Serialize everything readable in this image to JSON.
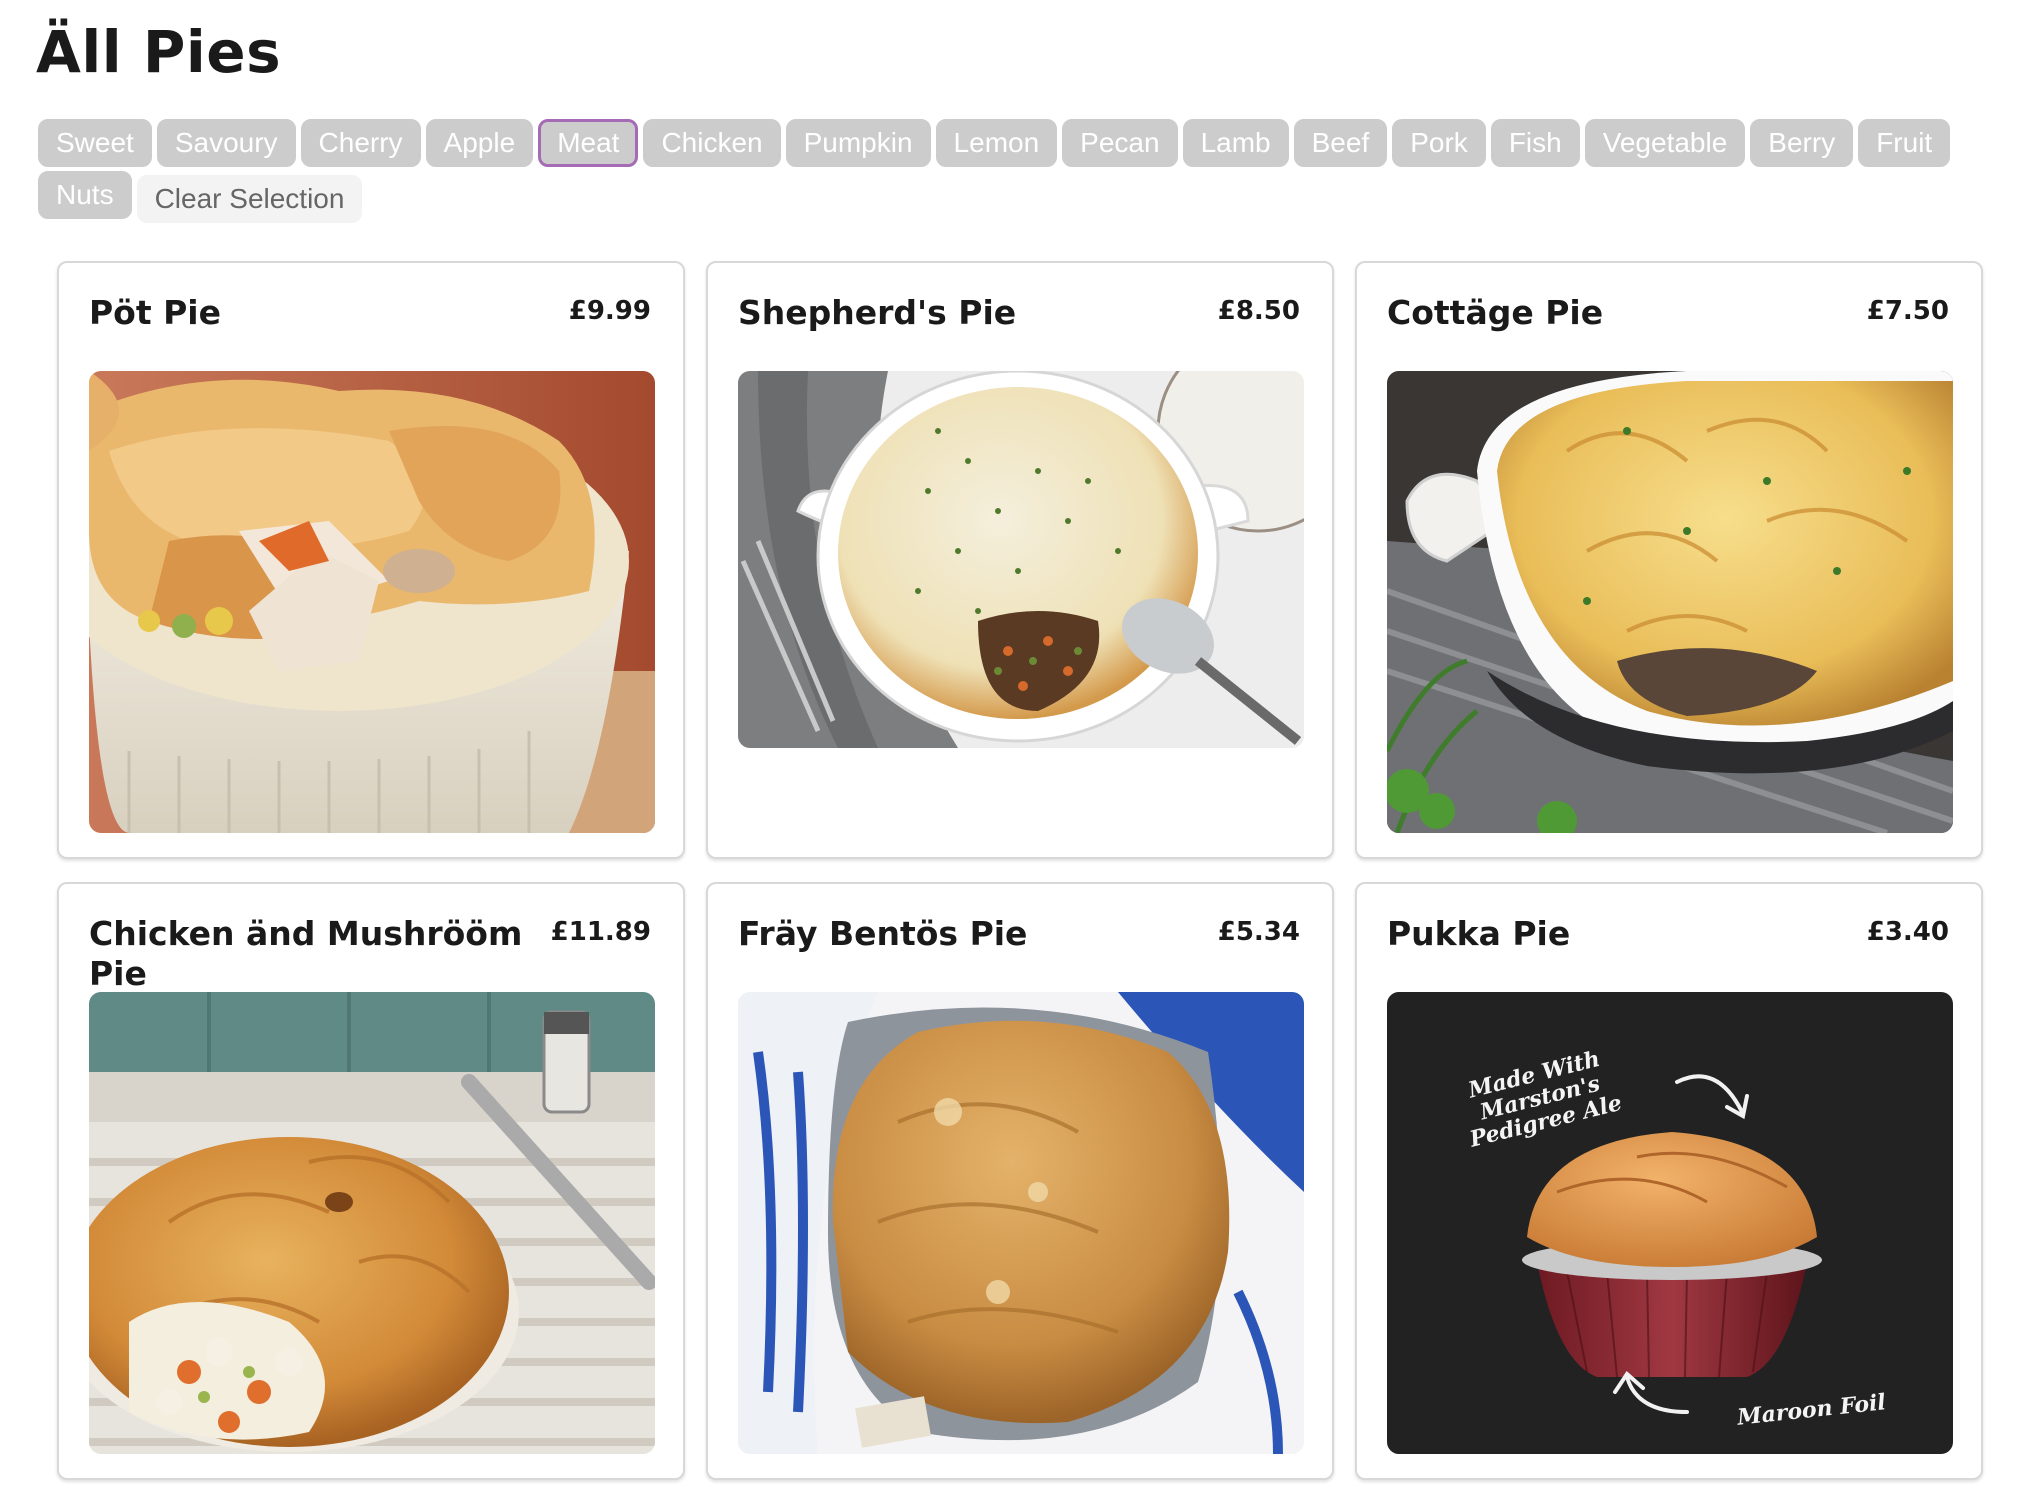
{
  "page": {
    "title": "Äll Pies"
  },
  "filters": {
    "items": [
      {
        "label": "Sweet",
        "selected": false
      },
      {
        "label": "Savoury",
        "selected": false
      },
      {
        "label": "Cherry",
        "selected": false
      },
      {
        "label": "Apple",
        "selected": false
      },
      {
        "label": "Meat",
        "selected": true
      },
      {
        "label": "Chicken",
        "selected": false
      },
      {
        "label": "Pumpkin",
        "selected": false
      },
      {
        "label": "Lemon",
        "selected": false
      },
      {
        "label": "Pecan",
        "selected": false
      },
      {
        "label": "Lamb",
        "selected": false
      },
      {
        "label": "Beef",
        "selected": false
      },
      {
        "label": "Pork",
        "selected": false
      },
      {
        "label": "Fish",
        "selected": false
      },
      {
        "label": "Vegetable",
        "selected": false
      },
      {
        "label": "Berry",
        "selected": false
      },
      {
        "label": "Fruit",
        "selected": false
      },
      {
        "label": "Nuts",
        "selected": false
      }
    ],
    "clear_label": "Clear Selection"
  },
  "products": [
    {
      "name": "Pöt Pie",
      "price": "£9.99"
    },
    {
      "name": "Shepherd's Pie",
      "price": "£8.50"
    },
    {
      "name": "Cottäge Pie",
      "price": "£7.50"
    },
    {
      "name": "Chicken änd Mushrööm Pie",
      "price": "£11.89"
    },
    {
      "name": "Fräy Bentös Pie",
      "price": "£5.34"
    },
    {
      "name": "Pukka Pie",
      "price": "£3.40"
    }
  ],
  "pukka_annotations": {
    "top": "Made With Marston's Pedigree Ale",
    "bottom": "Maroon Foil"
  },
  "colors": {
    "chip_bg": "#cccccc",
    "chip_selected_border": "#a56cb5",
    "card_border": "#d8d8d8"
  }
}
